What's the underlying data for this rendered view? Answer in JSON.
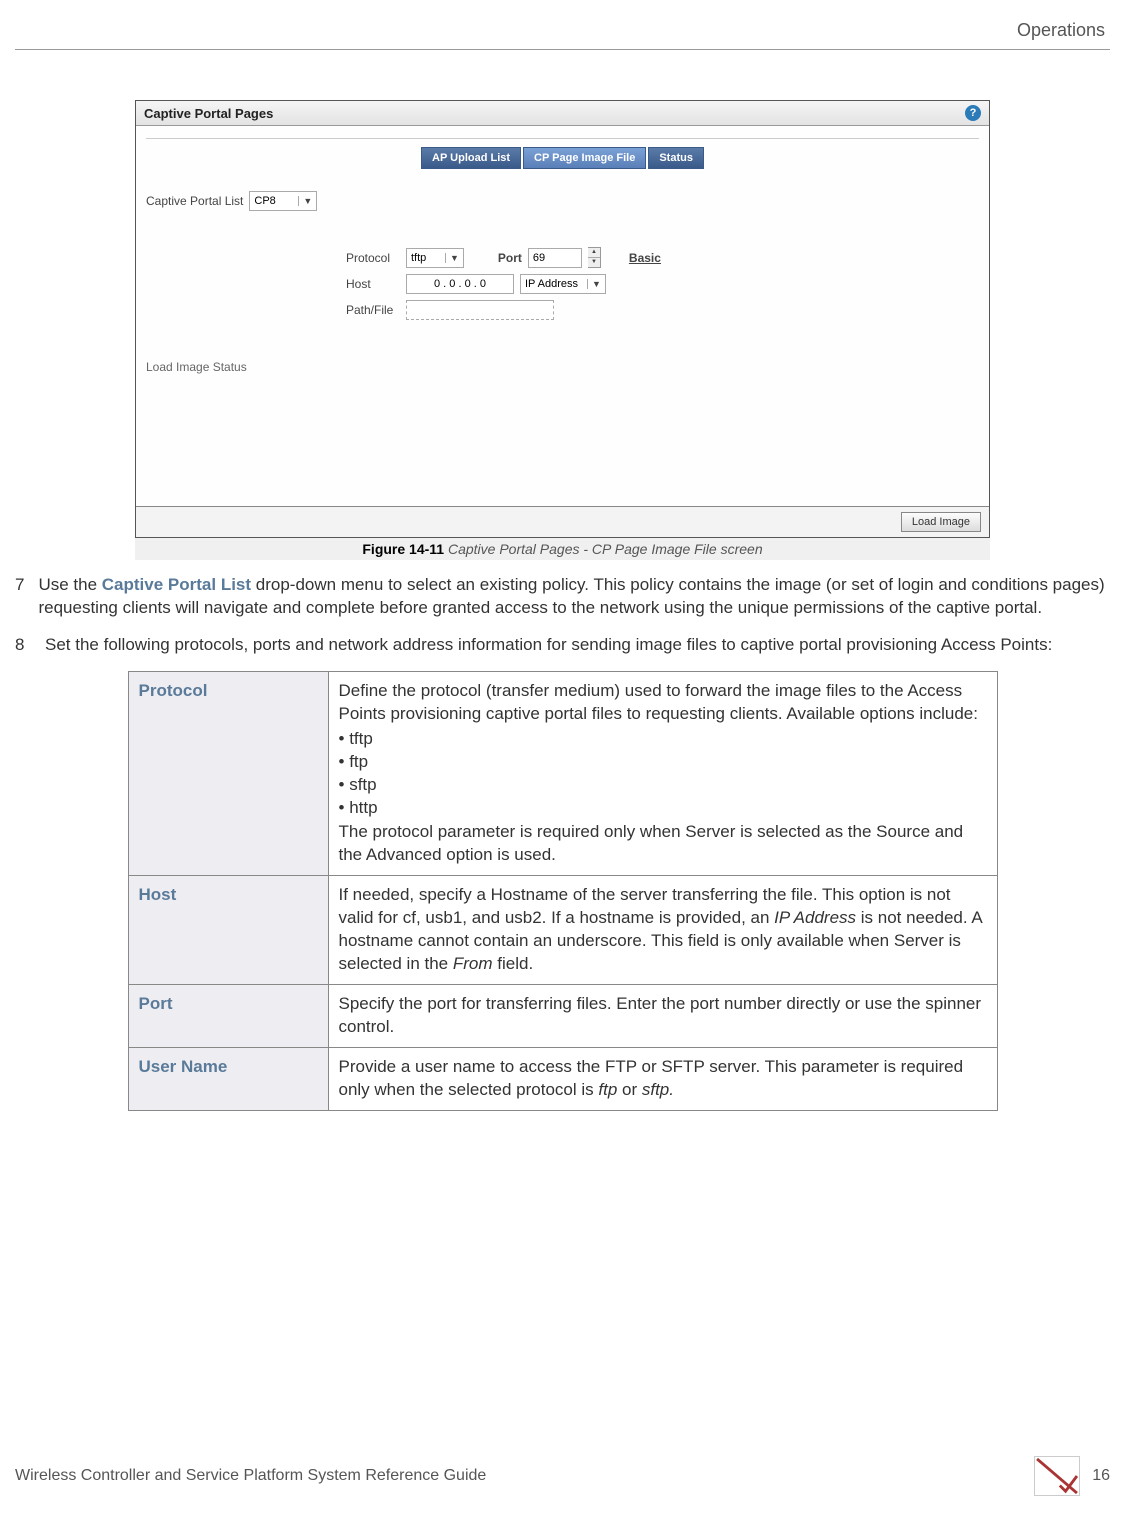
{
  "header": {
    "section": "Operations"
  },
  "screenshot": {
    "panel_title": "Captive Portal Pages",
    "tabs": {
      "t1": "AP Upload List",
      "t2": "CP Page Image File",
      "t3": "Status"
    },
    "cp_list_label": "Captive Portal List",
    "cp_list_value": "CP8",
    "protocol_label": "Protocol",
    "protocol_value": "tftp",
    "port_label": "Port",
    "port_value": "69",
    "basic_link": "Basic",
    "host_label": "Host",
    "host_value": "0 . 0 . 0 . 0",
    "host_type": "IP Address",
    "pathfile_label": "Path/File",
    "pathfile_value": "",
    "load_status_label": "Load Image Status",
    "load_image_btn": "Load Image"
  },
  "figure": {
    "num": "Figure 14-11",
    "caption": "Captive Portal Pages - CP Page Image File screen"
  },
  "step7": {
    "num": "7",
    "pre": "Use the ",
    "bold": "Captive Portal List",
    "post": " drop-down menu to select an existing policy. This policy contains the image (or set of login and conditions pages) requesting clients will navigate and complete before granted access to the network using the unique permissions of the captive portal."
  },
  "step8": {
    "num": "8",
    "text": "Set the following protocols, ports and network address information for sending image files to captive portal provisioning Access Points:"
  },
  "table": {
    "r1": {
      "label": "Protocol",
      "p1": "Define the protocol (transfer medium) used to forward the image files to the Access Points provisioning captive portal files to requesting clients. Available options include:",
      "b1": "tftp",
      "b2": "ftp",
      "b3": "sftp",
      "b4": "http",
      "p2": "The protocol parameter is required only when Server is selected as the Source and the Advanced option is used."
    },
    "r2": {
      "label": "Host",
      "p1a": "If needed, specify a Hostname of the server transferring the file. This option is not valid for cf, usb1, and usb2. If a hostname is provided, an ",
      "it1": "IP Address",
      "p1b": " is not needed. A hostname cannot contain an underscore. This field is only available when Server is selected in the ",
      "it2": "From",
      "p1c": " field."
    },
    "r3": {
      "label": "Port",
      "p1": "Specify the port for transferring files. Enter the port number directly or use the spinner control."
    },
    "r4": {
      "label": "User Name",
      "p1a": "Provide a user name to access the FTP or SFTP server. This parameter is required only when the selected protocol is ",
      "it1": "ftp",
      "p1b": " or ",
      "it2": "sftp.",
      "p1c": ""
    }
  },
  "footer": {
    "title": "Wireless Controller and Service Platform System Reference Guide",
    "page": "16"
  }
}
